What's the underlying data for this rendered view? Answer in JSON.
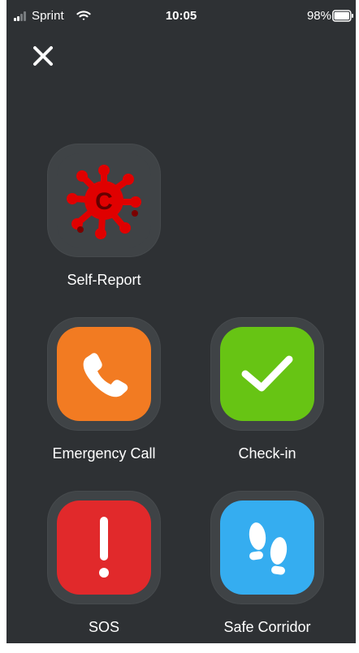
{
  "status_bar": {
    "carrier": "Sprint",
    "time": "10:05",
    "battery": "98%",
    "signal_icon": "signal-icon",
    "wifi_icon": "wifi-icon",
    "battery_icon": "battery-icon"
  },
  "header": {
    "close_icon": "close-icon"
  },
  "actions": [
    {
      "label": "Self-Report",
      "icon": "virus-icon",
      "color": "#3f4346"
    },
    {
      "label": "Emergency Call",
      "icon": "phone-icon",
      "color": "#f27b22"
    },
    {
      "label": "Check-in",
      "icon": "checkmark-icon",
      "color": "#67c414"
    },
    {
      "label": "SOS",
      "icon": "exclamation-icon",
      "color": "#e1292b"
    },
    {
      "label": "Safe Corridor",
      "icon": "footsteps-icon",
      "color": "#35adf0"
    }
  ],
  "colors": {
    "background": "#2e3134",
    "ring": "#3f4346",
    "text": "#ffffff"
  }
}
